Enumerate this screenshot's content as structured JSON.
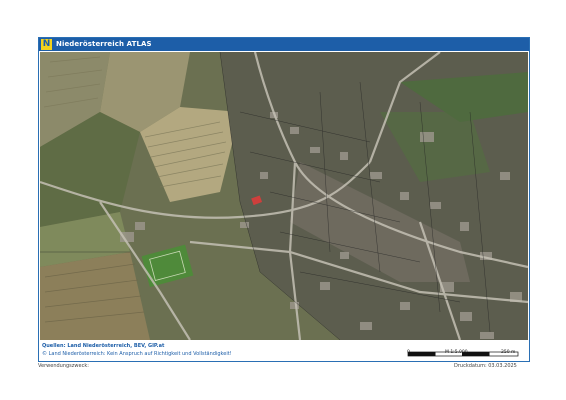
{
  "header": {
    "logo_letter": "N",
    "title": "Niederösterreich ATLAS"
  },
  "footer": {
    "sources": "Quellen: Land Niederösterreich, BEV, GIP.at",
    "disclaimer": "© Land Niederösterreich: Kein Anspruch auf Richtigkeit und Vollständigkeit!",
    "scale_start": "0",
    "scale_ratio": "M 1:5.000",
    "scale_end": "250 m"
  },
  "below": {
    "purpose_label": "Verwendungszweck:",
    "print_date": "Druckdatum: 03.03.2025"
  },
  "colors": {
    "header_blue": "#1d5ea8",
    "logo_yellow": "#f2d21b",
    "marker_red": "#e23a3a"
  }
}
